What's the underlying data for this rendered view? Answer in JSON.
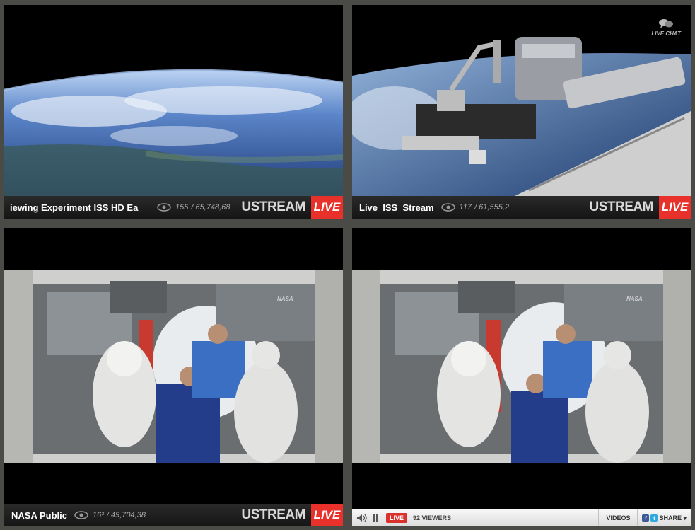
{
  "streams": [
    {
      "title": "iewing Experiment    ISS HD Ea",
      "viewers_current": "155",
      "viewers_total": "/ 65,748,68",
      "brand": "USTREAM",
      "live_label": "LIVE"
    },
    {
      "title": "Live_ISS_Stream",
      "viewers_current": "117",
      "viewers_total": "/ 61,555,2",
      "brand": "USTREAM",
      "live_label": "LIVE",
      "overlay": "LIVE CHAT"
    },
    {
      "title": "NASA Public",
      "viewers_current": "16³",
      "viewers_total": "/ 49,704,38",
      "brand": "USTREAM",
      "live_label": "LIVE",
      "watermark": "NASA"
    },
    {
      "watermark": "NASA",
      "controls": {
        "live_label": "LIVE",
        "viewers_text": "92  VIEWERS",
        "videos_label": "VIDEOS",
        "share_label": "SHARE ▾"
      }
    }
  ],
  "icons": [
    "eye-icon",
    "chat-bubble-icon",
    "speaker-icon",
    "pause-icon",
    "facebook-icon",
    "twitter-icon"
  ],
  "colors": {
    "live_red": "#e8312a",
    "background": "#4a4a46",
    "bar": "#1c1c1c"
  }
}
